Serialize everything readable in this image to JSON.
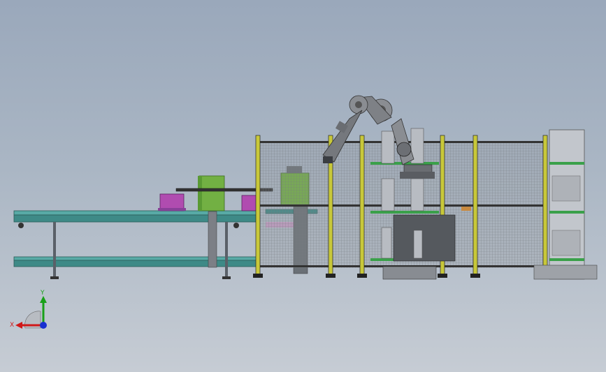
{
  "viewport": {
    "background_top": "#9aa8bb",
    "background_bottom": "#c6ccd4"
  },
  "triad": {
    "x_label": "X",
    "y_label": "Y",
    "x_color": "#d01818",
    "y_color": "#18a018",
    "z_color": "#1830d0"
  },
  "colors": {
    "conveyor_teal": "#4a9a96",
    "frame_yellow": "#c8c83a",
    "frame_dark": "#222222",
    "mesh_grey": "#8b8f94",
    "robot_grey": "#8a8d92",
    "box_magenta": "#b04cb0",
    "block_green": "#72b043",
    "rack_green": "#3aa04a"
  }
}
